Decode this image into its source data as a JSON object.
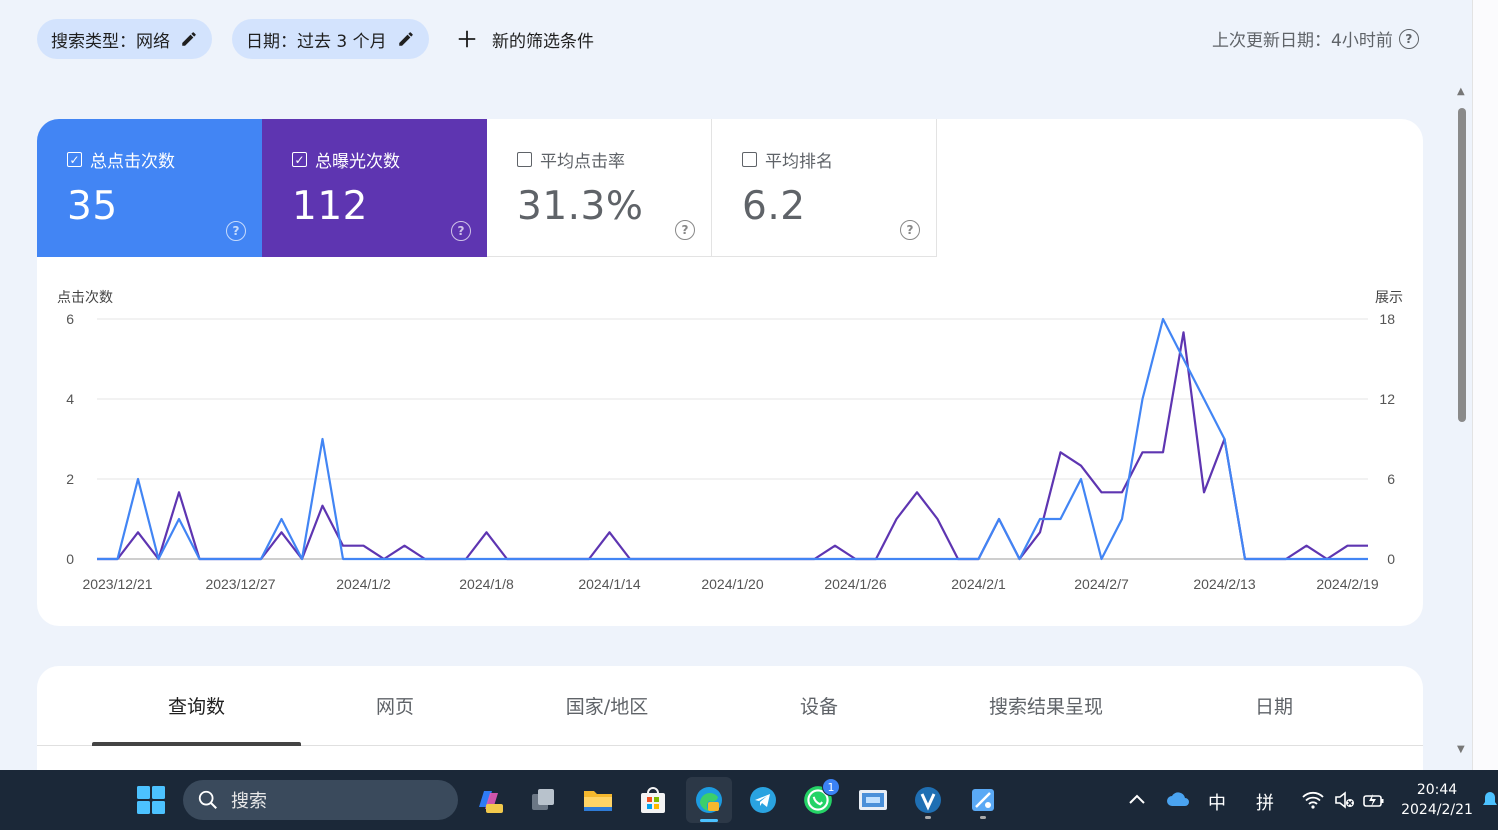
{
  "filters": {
    "search_type": "搜索类型：网络",
    "date": "日期：过去 3 个月",
    "new_filter": "新的筛选条件",
    "last_update": "上次更新日期：4小时前"
  },
  "metrics": [
    {
      "label": "总点击次数",
      "value": "35",
      "checked": true
    },
    {
      "label": "总曝光次数",
      "value": "112",
      "checked": true
    },
    {
      "label": "平均点击率",
      "value": "31.3%",
      "checked": false
    },
    {
      "label": "平均排名",
      "value": "6.2",
      "checked": false
    }
  ],
  "colors": {
    "clicks": "#4285f4",
    "impressions": "#5e35b1"
  },
  "chart_data": {
    "type": "line",
    "ylabel": "点击次数",
    "y2label": "展示",
    "ylim": [
      0,
      6
    ],
    "y2lim": [
      0,
      18
    ],
    "yticks": [
      0,
      2,
      4,
      6
    ],
    "y2ticks": [
      0,
      6,
      12,
      18
    ],
    "x_start": "2023/12/20",
    "x_tick_labels": [
      "2023/12/21",
      "2023/12/27",
      "2024/1/2",
      "2024/1/8",
      "2024/1/14",
      "2024/1/20",
      "2024/1/26",
      "2024/2/1",
      "2024/2/7",
      "2024/2/13",
      "2024/2/19"
    ],
    "grid": true,
    "series": [
      {
        "axis": "left",
        "values": [
          0,
          0,
          2,
          0,
          1,
          0,
          0,
          0,
          0,
          1,
          0,
          3,
          0,
          0,
          0,
          0,
          0,
          0,
          0,
          0,
          0,
          0,
          0,
          0,
          0,
          0,
          0,
          0,
          0,
          0,
          0,
          0,
          0,
          0,
          0,
          0,
          0,
          0,
          0,
          0,
          0,
          0,
          0,
          0,
          1,
          0,
          1,
          1,
          2,
          0,
          1,
          4,
          6,
          5,
          4,
          3,
          0,
          0,
          0,
          0,
          0,
          0,
          0
        ]
      },
      {
        "axis": "right",
        "values": [
          0,
          0,
          2,
          0,
          5,
          0,
          0,
          0,
          0,
          2,
          0,
          4,
          1,
          1,
          0,
          1,
          0,
          0,
          0,
          2,
          0,
          0,
          0,
          0,
          0,
          2,
          0,
          0,
          0,
          0,
          0,
          0,
          0,
          0,
          0,
          0,
          1,
          0,
          0,
          3,
          5,
          3,
          0,
          0,
          3,
          0,
          2,
          8,
          7,
          5,
          5,
          8,
          8,
          17,
          5,
          9,
          0,
          0,
          0,
          1,
          0,
          1,
          1
        ]
      }
    ]
  },
  "tabs": [
    "查询数",
    "网页",
    "国家/地区",
    "设备",
    "搜索结果呈现",
    "日期"
  ],
  "taskbar": {
    "search_placeholder": "搜索",
    "whatsapp_badge": "1",
    "ime_mode": "中",
    "ime_input": "拼",
    "time": "20:44",
    "date": "2024/2/21"
  }
}
